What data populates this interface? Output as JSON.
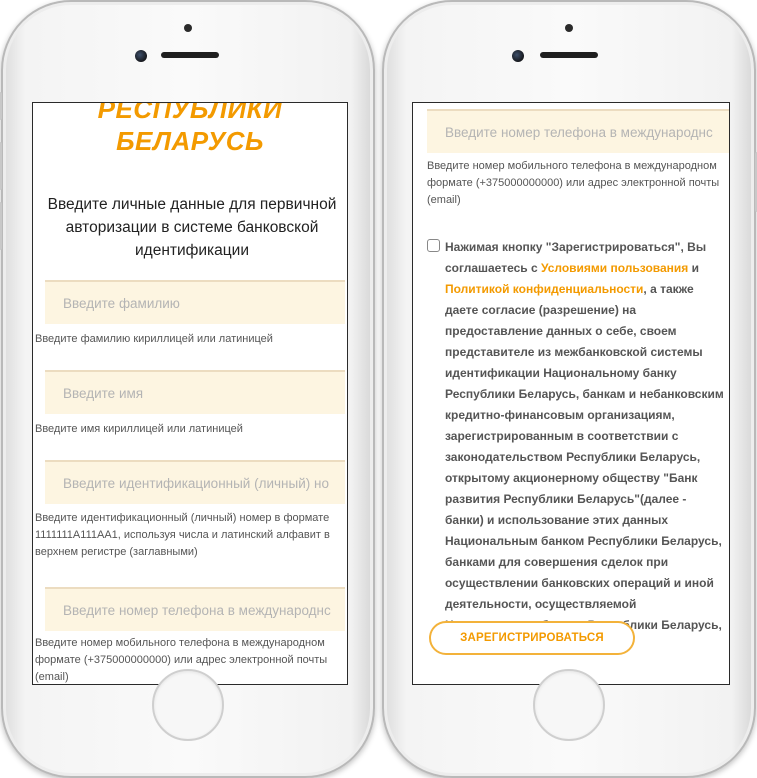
{
  "left_screen": {
    "title_line1": "РЕСПУБЛИКИ",
    "title_line2": "БЕЛАРУСЬ",
    "intro": "Введите личные данные для первичной авторизации в системе банковской идентификации",
    "fields": [
      {
        "placeholder": "Введите фамилию",
        "hint": "Введите фамилию кириллицей или латиницей"
      },
      {
        "placeholder": "Введите имя",
        "hint": "Введите имя кириллицей или латиницей"
      },
      {
        "placeholder": "Введите идентификационный (личный) но",
        "hint": "Введите идентификационный (личный) номер в формате 1111111A111AA1, используя числа и латинский алфавит в верхнем регистре (заглавными)"
      },
      {
        "placeholder": "Введите номер телефона в международнс",
        "hint": "Введите номер мобильного телефона в международном формате (+375000000000) или адрес электронной почты (email)"
      }
    ]
  },
  "right_screen": {
    "phone_field": {
      "placeholder": "Введите номер телефона в международнс",
      "hint": "Введите номер мобильного телефона в международном формате (+375000000000) или адрес электронной почты (email)"
    },
    "consent": {
      "text_before": "Нажимая кнопку \"Зарегистрироваться\", Вы соглашаетесь с ",
      "link_terms": "Условиями пользования",
      "text_and": " и ",
      "link_privacy": "Политикой конфиденциальности",
      "text_after": ", а также даете согласие (разрешение) на предоставление данных о себе, своем представителе из межбанковской системы идентификации Национальному банку Республики Беларусь, банкам и небанковским кредитно-финансовым организациям, зарегистрированным в соответствии с законодательством Республики Беларусь, открытому акционерному обществу \"Банк развития Республики Беларусь\"(далее - банки) и использование этих данных Национальным банком Республики Беларусь, банками для совершения сделок при осуществлении банковских операций и иной деятельности, осуществляемой Национальным банком Республики Беларусь, банками"
    },
    "register_button": "ЗАРЕГИСТРИРОВАТЬСЯ"
  },
  "colors": {
    "accent": "#f39a00",
    "field_background": "#fdf5e1",
    "hint_text": "#555555"
  }
}
